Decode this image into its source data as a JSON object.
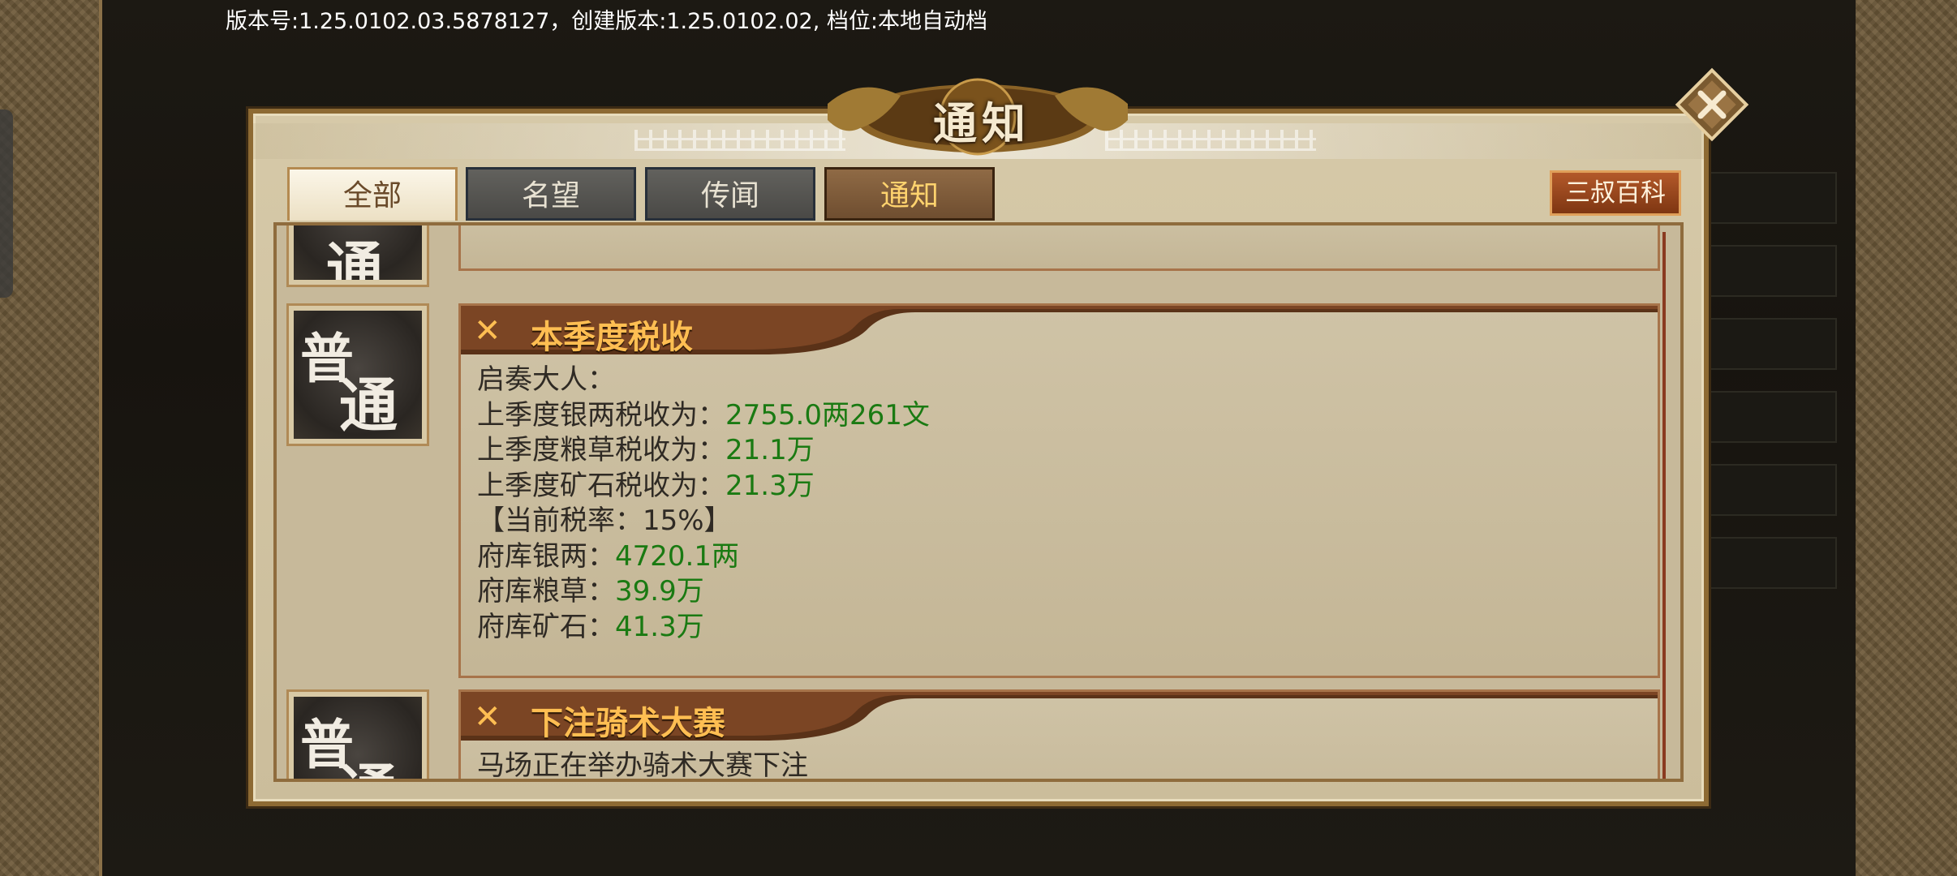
{
  "version_text": "版本号:1.25.0102.03.5878127，创建版本:1.25.0102.02, 档位:本地自动档",
  "dialog": {
    "title": "通知",
    "tabs": [
      "全部",
      "名望",
      "传闻",
      "通知"
    ],
    "encyclopedia_button": "三叔百科"
  },
  "notices": [
    {
      "badge": [
        "普",
        "通"
      ],
      "title": "本季度税收",
      "lines": [
        {
          "label": "启奏大人：",
          "value": ""
        },
        {
          "label": "上季度银两税收为：",
          "value": "2755.0两261文"
        },
        {
          "label": "上季度粮草税收为：",
          "value": "21.1万"
        },
        {
          "label": "上季度矿石税收为：",
          "value": "21.3万"
        },
        {
          "label": "【当前税率：15%】",
          "value": ""
        },
        {
          "label": "府库银两：",
          "value": "4720.1两"
        },
        {
          "label": "府库粮草：",
          "value": "39.9万"
        },
        {
          "label": "府库矿石：",
          "value": "41.3万"
        }
      ]
    },
    {
      "badge": [
        "普",
        "通"
      ],
      "title": "下注骑术大赛",
      "lines": [
        {
          "label": "马场正在举办骑术大赛下注",
          "value": ""
        }
      ]
    }
  ],
  "colors": {
    "highlight_value": "#1a7a12",
    "card_title": "#ffbe52",
    "frame": "#8d6a33"
  }
}
